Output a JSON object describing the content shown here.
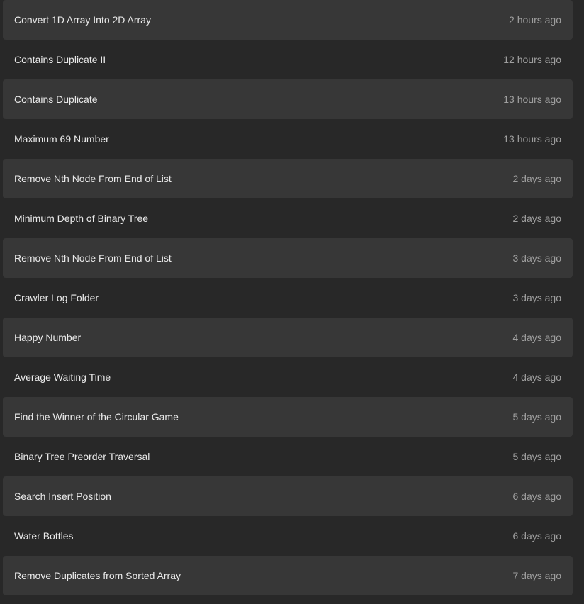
{
  "submissions": [
    {
      "title": "Convert 1D Array Into 2D Array",
      "time": "2 hours ago"
    },
    {
      "title": "Contains Duplicate II",
      "time": "12 hours ago"
    },
    {
      "title": "Contains Duplicate",
      "time": "13 hours ago"
    },
    {
      "title": "Maximum 69 Number",
      "time": "13 hours ago"
    },
    {
      "title": "Remove Nth Node From End of List",
      "time": "2 days ago"
    },
    {
      "title": "Minimum Depth of Binary Tree",
      "time": "2 days ago"
    },
    {
      "title": "Remove Nth Node From End of List",
      "time": "3 days ago"
    },
    {
      "title": "Crawler Log Folder",
      "time": "3 days ago"
    },
    {
      "title": "Happy Number",
      "time": "4 days ago"
    },
    {
      "title": "Average Waiting Time",
      "time": "4 days ago"
    },
    {
      "title": "Find the Winner of the Circular Game",
      "time": "5 days ago"
    },
    {
      "title": "Binary Tree Preorder Traversal",
      "time": "5 days ago"
    },
    {
      "title": "Search Insert Position",
      "time": "6 days ago"
    },
    {
      "title": "Water Bottles",
      "time": "6 days ago"
    },
    {
      "title": "Remove Duplicates from Sorted Array",
      "time": "7 days ago"
    }
  ],
  "colors": {
    "background": "#282828",
    "row_alt": "#373737",
    "title_text": "#eaeaea",
    "time_text": "#9f9f9f"
  }
}
